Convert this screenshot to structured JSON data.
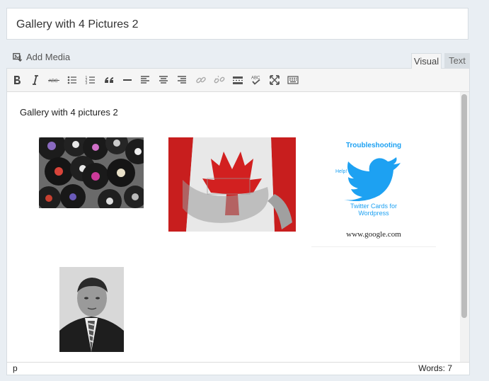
{
  "post": {
    "title": "Gallery with 4 Pictures 2"
  },
  "media": {
    "add_media_label": "Add Media"
  },
  "tabs": {
    "visual": "Visual",
    "text": "Text"
  },
  "toolbar": {
    "buttons": [
      "bold",
      "italic",
      "strikethrough",
      "bulleted-list",
      "numbered-list",
      "blockquote",
      "horizontal-line",
      "align-left",
      "align-center",
      "align-right",
      "insert-link",
      "remove-link",
      "read-more",
      "spellcheck",
      "fullscreen",
      "toolbar-toggle"
    ]
  },
  "content": {
    "heading": "Gallery with 4 pictures 2",
    "gallery": [
      {
        "subject": "vinyl records"
      },
      {
        "subject": "canada flag 3d"
      },
      {
        "subject": "twitter bird",
        "title_text": "Troubleshooting",
        "help_text": "Help!",
        "caption_line1": "Twitter Cards for",
        "caption_line2": "Wordpress",
        "footer_text": "www.google.com"
      },
      {
        "subject": "black and white portrait"
      }
    ]
  },
  "status": {
    "path": "p",
    "words": "Words: 7"
  },
  "colors": {
    "twitter_blue": "#1da1f2",
    "flag_red": "#d92020",
    "page_bg": "#e9eef3"
  }
}
